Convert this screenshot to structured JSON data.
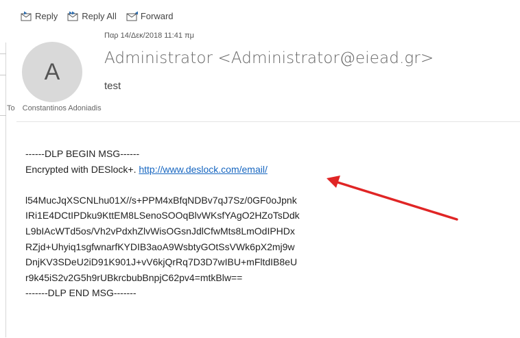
{
  "actions": {
    "reply": "Reply",
    "reply_all": "Reply All",
    "forward": "Forward"
  },
  "message": {
    "date": "Παρ 14/Δεκ/2018 11:41 πμ",
    "avatar_initial": "A",
    "sender": "Administrator <Administrator@eiead.gr>",
    "subject": "test",
    "to_label": "To",
    "recipient": "Constantinos Adoniadis"
  },
  "body": {
    "begin_marker": "------DLP BEGIN MSG------",
    "encrypted_text": "Encrypted with DESlock+. ",
    "link": "http://www.deslock.com/email/",
    "cipher_lines": [
      "l54MucJqXSCNLhu01X//s+PPM4xBfqNDBv7qJ7Sz/0GF0oJpnk",
      "IRi1E4DCtIPDku9KttEM8LSenoSOOqBlvWKsfYAgO2HZoTsDdk",
      "L9bIAcWTd5os/Vh2vPdxhZlvWisOGsnJdlCfwMts8LmOdIPHDx",
      "RZjd+Uhyiq1sgfwnarfKYDIB3aoA9WsbtyGOtSsVWk6pX2mj9w",
      "DnjKV3SDeU2iD91K901J+vV6kjQrRq7D3D7wIBU+mFltdIB8eU",
      "r9k45iS2v2G5h9rUBkrcbubBnpjC62pv4=mtkBlw=="
    ],
    "end_marker": "-------DLP END MSG-------"
  },
  "colors": {
    "link": "#1565c0",
    "annotation_arrow": "#e02525",
    "avatar_bg": "#d9d9d9"
  }
}
